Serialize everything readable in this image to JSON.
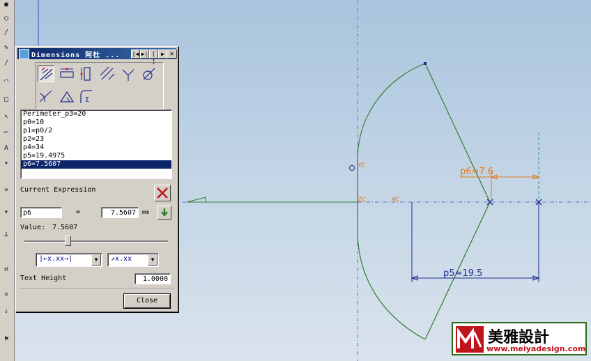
{
  "dialog": {
    "title": "Dimensions 阿杜 ...",
    "title_buttons": [
      "|◀",
      "▶|",
      "[ ]",
      "▶",
      "✕"
    ],
    "tools": [
      {
        "name": "inferred-dimension-icon"
      },
      {
        "name": "horizontal-dimension-icon"
      },
      {
        "name": "vertical-dimension-icon"
      },
      {
        "name": "parallel-dimension-icon"
      },
      {
        "name": "perpendicular-dimension-icon"
      },
      {
        "name": "diameter-dimension-icon"
      },
      {
        "name": "angular-dimension-icon"
      },
      {
        "name": "cylindrical-dimension-icon"
      },
      {
        "name": "perimeter-dimension-icon"
      }
    ],
    "expressions": [
      "Perimeter_p3=20",
      "p0=10",
      "p1=p0/2",
      "p2=23",
      "p4=34",
      "p5=19.4975",
      "p6=7.5607"
    ],
    "selected_index": 6,
    "current_expression_label": "Current Expression",
    "name_value": "p6",
    "equals": "=",
    "expr_value": "7.5607",
    "unit": "mm",
    "value_label": "Value:",
    "value": "7.5607",
    "slider_fraction": 0.3,
    "placement_option": "|←x.xx→|",
    "text_option": "↗x.xx",
    "text_height_label": "Text Height",
    "text_height": "1.0000",
    "close_label": "Close"
  },
  "sketch": {
    "label_yc": "YC",
    "label_zc": "ZC",
    "label_xc": "XC",
    "dim_p6": "p6=7.6",
    "dim_p5": "p5=19.5",
    "colors": {
      "curve": "#2f7d2f",
      "dimension": "#1f2a8c",
      "dimension_active": "#e07a1a",
      "centerline": "#5575c0"
    }
  },
  "watermark": {
    "title": "美雅設計",
    "url": "www.meiyadesign.com"
  }
}
